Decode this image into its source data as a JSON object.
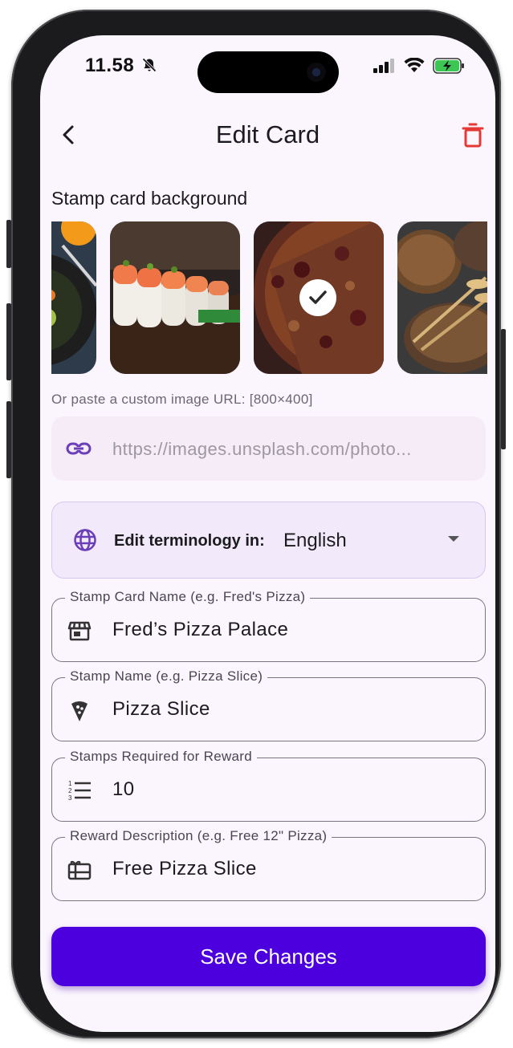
{
  "status_bar": {
    "time": "11.58"
  },
  "header": {
    "title": "Edit Card"
  },
  "background_section": {
    "label": "Stamp card background",
    "images": [
      {
        "name": "salad-image"
      },
      {
        "name": "sushi-image"
      },
      {
        "name": "pizza-image",
        "selected": true
      },
      {
        "name": "bread-image"
      }
    ]
  },
  "custom_url": {
    "hint": "Or paste a custom image URL: [800×400]",
    "placeholder": "https://images.unsplash.com/photo..."
  },
  "language": {
    "label": "Edit terminology in:",
    "value": "English"
  },
  "fields": {
    "card_name": {
      "label": "Stamp Card Name (e.g. Fred's Pizza)",
      "value": "Fred’s Pizza Palace",
      "icon": "storefront-icon"
    },
    "stamp_name": {
      "label": "Stamp Name (e.g. Pizza Slice)",
      "value": "Pizza Slice",
      "icon": "pizza-slice-icon"
    },
    "stamps_required": {
      "label": "Stamps Required for Reward",
      "value": "10",
      "icon": "numbered-list-icon"
    },
    "reward": {
      "label": "Reward Description (e.g. Free 12\" Pizza)",
      "value": "Free Pizza Slice",
      "icon": "gift-card-icon"
    }
  },
  "actions": {
    "save_label": "Save Changes"
  },
  "colors": {
    "accent": "#4c00dd",
    "selected_border": "#5b3aa8",
    "delete": "#e53935",
    "background": "#fbf5fd"
  }
}
